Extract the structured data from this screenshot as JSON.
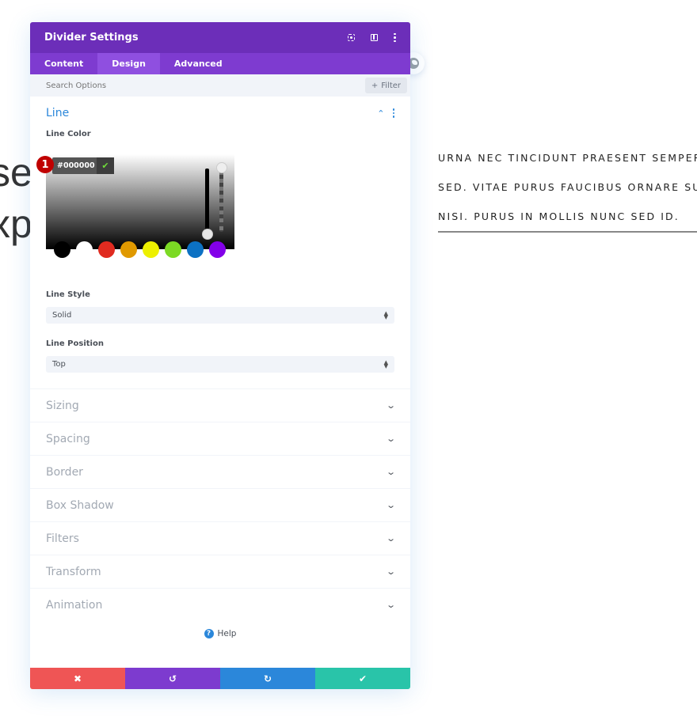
{
  "background": {
    "heading_lines": [
      "se",
      "xp"
    ],
    "text_lines": [
      "URNA NEC TINCIDUNT PRAESENT SEMPER FE",
      "SED. VITAE PURUS FAUCIBUS ORNARE SUSP",
      "NISI. PURUS IN MOLLIS NUNC SED ID."
    ]
  },
  "modal": {
    "title": "Divider Settings",
    "header_icons": [
      "expand-icon",
      "columns-icon",
      "more-icon"
    ],
    "tabs": [
      {
        "label": "Content",
        "active": false
      },
      {
        "label": "Design",
        "active": true
      },
      {
        "label": "Advanced",
        "active": false
      }
    ],
    "search": {
      "placeholder": "Search Options"
    },
    "filter": {
      "label": "Filter",
      "icon": "+"
    },
    "line_section": {
      "title": "Line",
      "line_color": {
        "label": "Line Color",
        "hex_value": "#000000",
        "badge": "1",
        "swatches": [
          "#000000",
          "#ffffff",
          "#e02b20",
          "#e09900",
          "#edf000",
          "#7cda24",
          "#0c71c3",
          "#8300e9"
        ]
      },
      "line_style": {
        "label": "Line Style",
        "value": "Solid"
      },
      "line_position": {
        "label": "Line Position",
        "value": "Top"
      }
    },
    "collapsed_sections": [
      "Sizing",
      "Spacing",
      "Border",
      "Box Shadow",
      "Filters",
      "Transform",
      "Animation"
    ],
    "help": {
      "label": "Help"
    },
    "footer": {
      "cancel": "✖",
      "undo": "↺",
      "redo": "↻",
      "save": "✔"
    }
  }
}
